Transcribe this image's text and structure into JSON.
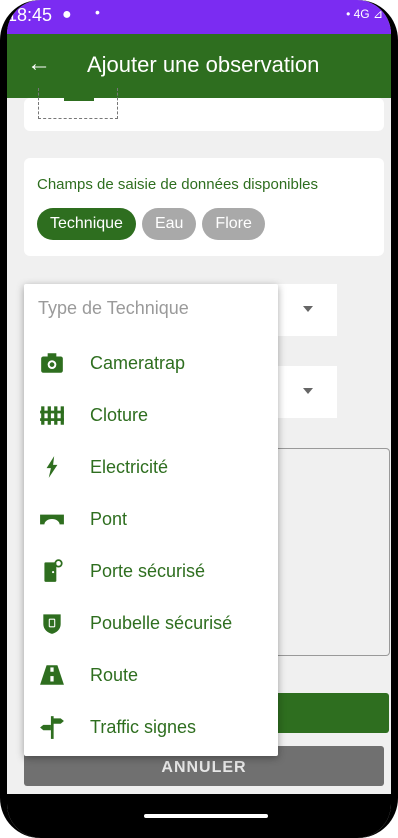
{
  "status": {
    "time": "18:45",
    "dot1": "●",
    "dot2": "•",
    "right": "• 4G ⊿"
  },
  "appbar": {
    "back": "←",
    "title": "Ajouter une observation"
  },
  "fields_card": {
    "title": "Champs de saisie de données disponibles",
    "chips": [
      "Technique",
      "Eau",
      "Flore"
    ]
  },
  "dropdown": {
    "header": "Type de Technique",
    "items": [
      {
        "label": "Cameratrap",
        "icon": "camera-icon"
      },
      {
        "label": "Cloture",
        "icon": "fence-icon"
      },
      {
        "label": "Electricité",
        "icon": "lightning-icon"
      },
      {
        "label": "Pont",
        "icon": "bridge-icon"
      },
      {
        "label": "Porte sécurisé",
        "icon": "door-icon"
      },
      {
        "label": "Poubelle sécurisé",
        "icon": "trash-icon"
      },
      {
        "label": "Route",
        "icon": "road-icon"
      },
      {
        "label": "Traffic signes",
        "icon": "signpost-icon"
      }
    ]
  },
  "cancel_button": "ANNULER",
  "colors": {
    "primary": "#2e6e1f",
    "status_bar": "#7b2cf2"
  }
}
